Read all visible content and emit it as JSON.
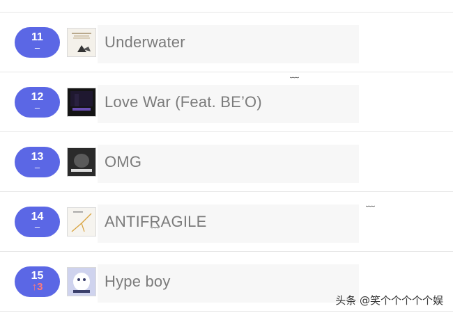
{
  "rows": [
    {
      "rank": "11",
      "change": "–",
      "title": "Underwater",
      "cover_color": "#f4f1ea"
    },
    {
      "rank": "12",
      "change": "–",
      "title": "Love War (Feat. BE’O)",
      "cover_color": "#141414"
    },
    {
      "rank": "13",
      "change": "–",
      "title": "OMG",
      "cover_color": "#2a2a2a"
    },
    {
      "rank": "14",
      "change": "–",
      "title": "ANTIFRAGILE",
      "cover_color": "#f6f4ef"
    },
    {
      "rank": "15",
      "change": "↑3",
      "title": "Hype boy",
      "cover_color": "#cfd3ee"
    }
  ],
  "watermark": "头条 @笑个个个个个娱",
  "colors": {
    "rank_badge": "#5b67e5",
    "rank_up": "#ff7a7a",
    "title_text": "#7b7b7b"
  }
}
